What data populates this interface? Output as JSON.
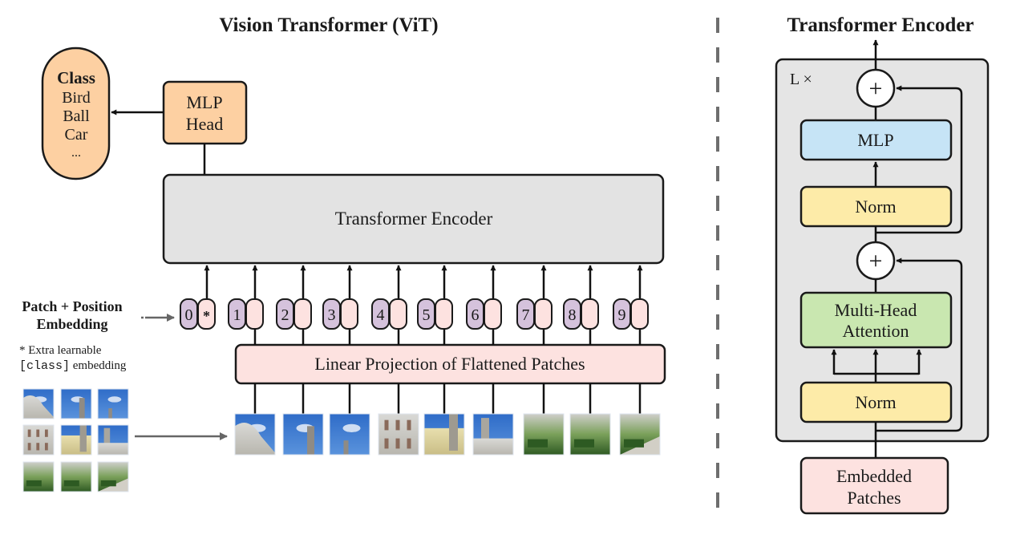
{
  "vit": {
    "title": "Vision Transformer (ViT)",
    "class_box": {
      "heading": "Class",
      "items": [
        "Bird",
        "Ball",
        "Car",
        "..."
      ]
    },
    "mlp_head": {
      "line1": "MLP",
      "line2": "Head"
    },
    "encoder_label": "Transformer Encoder",
    "embedding_label": {
      "line1": "Patch + Position",
      "line2": "Embedding"
    },
    "footnote": {
      "line1": "* Extra learnable",
      "code": "[class]",
      "rest": " embedding"
    },
    "tokens": [
      "0",
      "1",
      "2",
      "3",
      "4",
      "5",
      "6",
      "7",
      "8",
      "9"
    ],
    "class_token_mark": "*",
    "projection_label": "Linear Projection of Flattened Patches",
    "patch_count": 9,
    "grid": {
      "rows": 3,
      "cols": 3
    }
  },
  "encoder": {
    "title": "Transformer Encoder",
    "repeat_label": "L ×",
    "plus": "+",
    "mlp": "MLP",
    "norm_top": "Norm",
    "attention": {
      "line1": "Multi-Head",
      "line2": "Attention"
    },
    "norm_bottom": "Norm",
    "input": {
      "line1": "Embedded",
      "line2": "Patches"
    }
  },
  "colors": {
    "class_fill": "#fdd0a2",
    "mlp_head_fill": "#fdd0a2",
    "encoder_fill": "#e3e3e3",
    "position_fill": "#d5c2dc",
    "patch_fill": "#fde2e0",
    "projection_fill": "#fde2e0",
    "mlp_fill": "#c6e4f6",
    "norm_fill": "#fdeba8",
    "attention_fill": "#c9e7b0",
    "embedded_fill": "#fde2e0",
    "outer_fill": "#e5e5e5",
    "divider": "#6e6e6e",
    "stroke": "#1a1a1a"
  }
}
